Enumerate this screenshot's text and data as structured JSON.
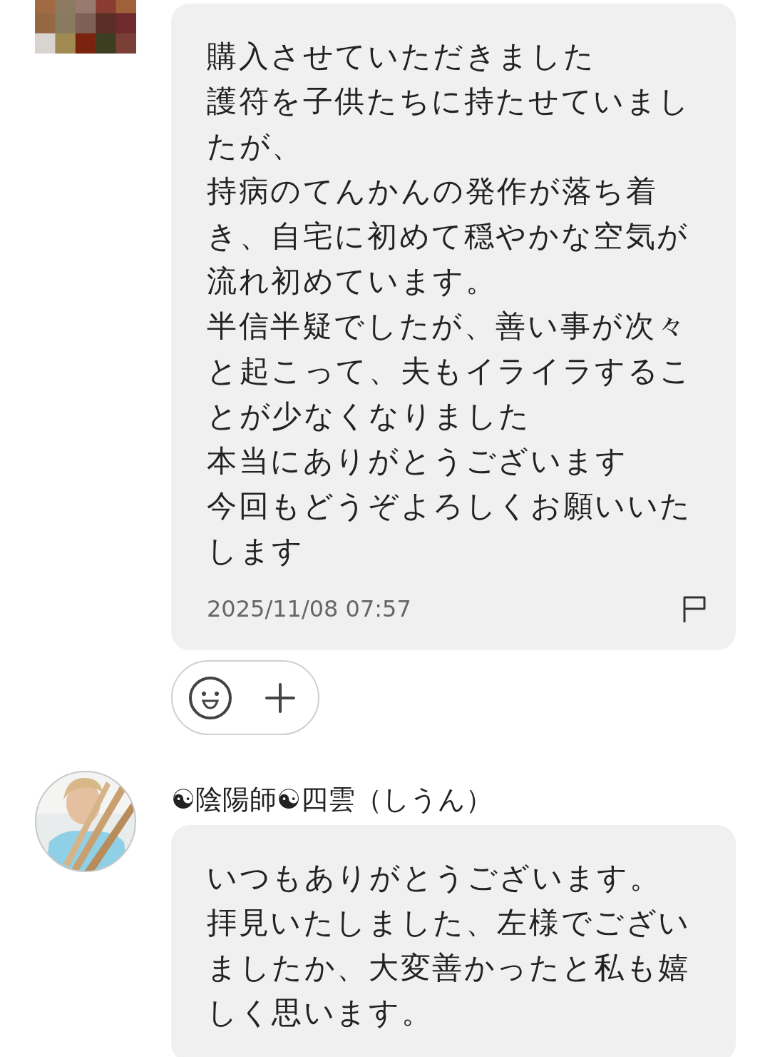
{
  "messages": [
    {
      "paragraphs": [
        "購入させていただきました",
        "護符を子供たちに持たせていましたが、",
        "持病のてんかんの発作が落ち着き、自宅に初めて穏やかな空気が流れ初めています。",
        "半信半疑でしたが、善い事が次々と起こって、夫もイライラすることが少なくなりました",
        "本当にありがとうございます",
        "今回もどうぞよろしくお願いいたします"
      ],
      "timestamp": "2025/11/08 07:57"
    },
    {
      "name": "☯陰陽師☯四雲（しうん）",
      "paragraphs": [
        "いつもありがとうございます。",
        "拝見いたしました、左様でございましたか、大変善かったと私も嬉しく思います。"
      ]
    }
  ]
}
